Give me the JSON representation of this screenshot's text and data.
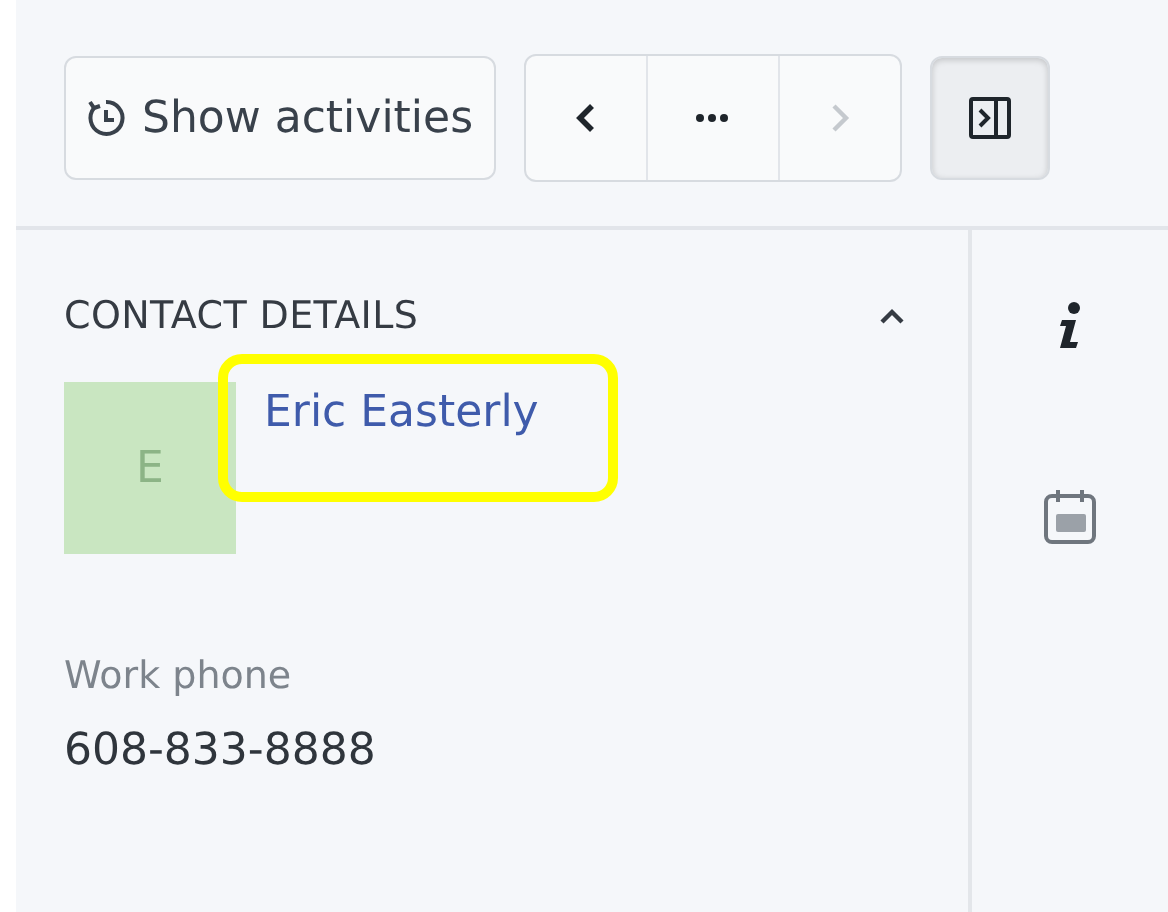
{
  "toolbar": {
    "activities_button": "Show activities",
    "nav": [
      {
        "kind": "prev",
        "disabled": false
      },
      {
        "kind": "more",
        "disabled": false
      },
      {
        "kind": "next",
        "disabled": true
      }
    ],
    "panel_toggle": {
      "selected": true
    }
  },
  "contact": {
    "heading": "CONTACT DETAILS",
    "expanded": true,
    "avatar": {
      "initial": "E",
      "color": "#c9e6c1"
    },
    "name": "Eric Easterly",
    "highlighted": true,
    "fields": [
      {
        "label": "Work phone",
        "value": "608-833-8888"
      }
    ]
  },
  "side_icons": [
    {
      "kind": "info"
    },
    {
      "kind": "calendar"
    }
  ]
}
